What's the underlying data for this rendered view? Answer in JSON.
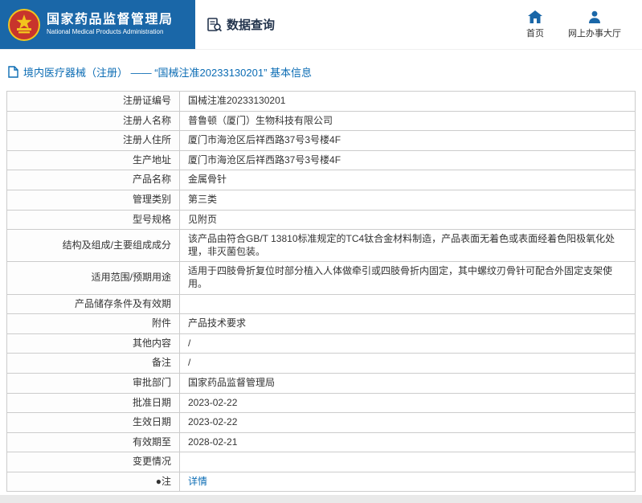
{
  "header": {
    "org_name_cn": "国家药品监督管理局",
    "org_name_en": "National Medical Products Administration",
    "nav_query_label": "数据查询",
    "nav_home_label": "首页",
    "nav_hall_label": "网上办事大厅"
  },
  "breadcrumb": {
    "title": "境内医疗器械（注册） ——  “国械注准20233130201”  基本信息"
  },
  "table": {
    "rows": [
      {
        "label": "注册证编号",
        "value": "国械注准20233130201",
        "link": false
      },
      {
        "label": "注册人名称",
        "value": "普鲁顿（厦门）生物科技有限公司",
        "link": false
      },
      {
        "label": "注册人住所",
        "value": "厦门市海沧区后祥西路37号3号楼4F",
        "link": false
      },
      {
        "label": "生产地址",
        "value": "厦门市海沧区后祥西路37号3号楼4F",
        "link": false
      },
      {
        "label": "产品名称",
        "value": "金属骨针",
        "link": false
      },
      {
        "label": "管理类别",
        "value": "第三类",
        "link": false
      },
      {
        "label": "型号规格",
        "value": "见附页",
        "link": false
      },
      {
        "label": "结构及组成/主要组成成分",
        "value": "该产品由符合GB/T 13810标准规定的TC4钛合金材料制造，产品表面无着色或表面经着色阳极氧化处理，非灭菌包装。",
        "link": false
      },
      {
        "label": "适用范围/预期用途",
        "value": "适用于四肢骨折复位时部分植入人体做牵引或四肢骨折内固定，其中螺纹刃骨针可配合外固定支架使用。",
        "link": false
      },
      {
        "label": "产品储存条件及有效期",
        "value": "",
        "link": false
      },
      {
        "label": "附件",
        "value": "产品技术要求",
        "link": false
      },
      {
        "label": "其他内容",
        "value": "/",
        "link": false
      },
      {
        "label": "备注",
        "value": "/",
        "link": false
      },
      {
        "label": "审批部门",
        "value": "国家药品监督管理局",
        "link": false
      },
      {
        "label": "批准日期",
        "value": "2023-02-22",
        "link": false
      },
      {
        "label": "生效日期",
        "value": "2023-02-22",
        "link": false
      },
      {
        "label": "有效期至",
        "value": "2028-02-21",
        "link": false
      },
      {
        "label": "变更情况",
        "value": "",
        "link": false
      },
      {
        "label": "●注",
        "value": "详情",
        "link": true
      }
    ]
  },
  "colors": {
    "header_blue": "#1a67a8",
    "link_blue": "#0b6cb4",
    "emblem_red": "#c8342c",
    "emblem_gold": "#f2c41d",
    "border_gray": "#cccccc"
  }
}
